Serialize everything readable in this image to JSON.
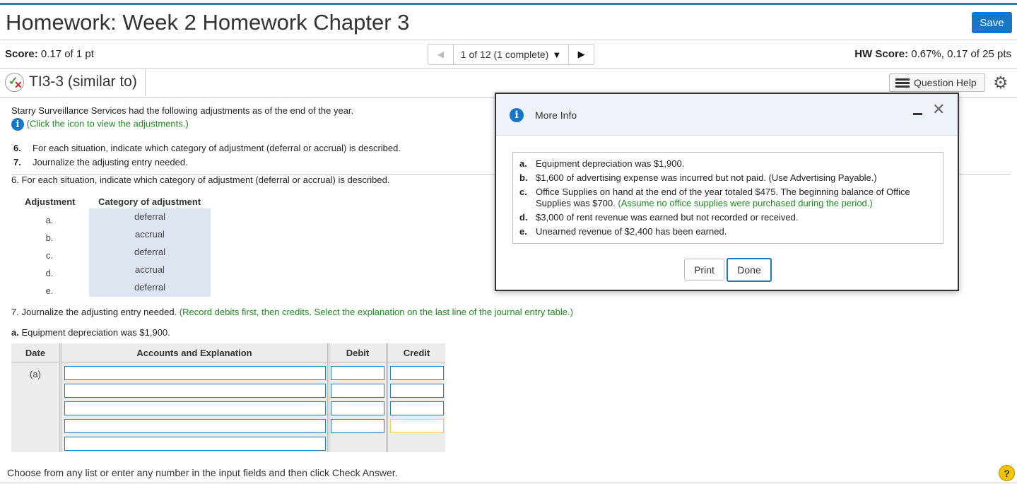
{
  "header": {
    "title": "Homework: Week 2 Homework Chapter 3",
    "save_label": "Save"
  },
  "status_bar": {
    "score_label": "Score:",
    "score_value": " 0.17 of 1 pt",
    "pager_text": "1 of 12 (1 complete)",
    "hw_score_label": "HW Score:",
    "hw_score_value": " 0.67%, 0.17 of 25 pts"
  },
  "question": {
    "title": "TI3-3 (similar to)",
    "help_label": "Question Help"
  },
  "body": {
    "intro": "Starry Surveillance Services had the following adjustments as of the end of the year.",
    "click_icon": "(Click the icon to view the adjustments.)",
    "req6_num": "6.",
    "req6_text": "For each situation, indicate which category of adjustment (deferral or accrual) is described.",
    "req7_num": "7.",
    "req7_text": "Journalize the adjusting entry needed.",
    "part6_heading": "6. For each situation, indicate which category of adjustment (deferral or accrual) is described.",
    "col_adjustment": "Adjustment",
    "col_category": "Category of adjustment",
    "adjustments": [
      {
        "letter": "a.",
        "category": "deferral"
      },
      {
        "letter": "b.",
        "category": "accrual"
      },
      {
        "letter": "c.",
        "category": "deferral"
      },
      {
        "letter": "d.",
        "category": "accrual"
      },
      {
        "letter": "e.",
        "category": "deferral"
      }
    ],
    "part7_heading": "7. Journalize the adjusting entry needed.",
    "part7_note": "(Record debits first, then credits. Select the explanation on the last line of the journal entry table.)",
    "part_a_label": "a.",
    "part_a_text": "Equipment depreciation was $1,900."
  },
  "journal": {
    "col_date": "Date",
    "col_accounts": "Accounts and Explanation",
    "col_debit": "Debit",
    "col_credit": "Credit",
    "date_value": "(a)"
  },
  "footer": {
    "instruction": "Choose from any list or enter any number in the input fields and then click Check Answer.",
    "help_symbol": "?"
  },
  "modal": {
    "title": "More Info",
    "items": [
      {
        "label": "a.",
        "text": "Equipment depreciation was $1,900."
      },
      {
        "label": "b.",
        "text": "$1,600 of advertising expense was incurred but not paid. (Use Advertising Payable.)"
      },
      {
        "label": "c.",
        "text": "Office Supplies on hand at the end of the year totaled $475. The beginning balance of Office Supplies was $700.",
        "note": "(Assume no office supplies were purchased during the period.)"
      },
      {
        "label": "d.",
        "text": "$3,000 of rent revenue was earned but not recorded or received."
      },
      {
        "label": "e.",
        "text": "Unearned revenue of $2,400 has been earned."
      }
    ],
    "print_label": "Print",
    "done_label": "Done"
  },
  "colors": {
    "accent": "#1677c9",
    "instruction_green": "#1e8a1e",
    "category_cell_bg": "#dde5f2"
  },
  "icons": [
    "info-icon",
    "gear-icon",
    "question-help-list-icon",
    "close-icon",
    "minimize-icon",
    "prev-arrow-icon",
    "next-arrow-icon",
    "dropdown-caret-icon",
    "partial-credit-status-icon",
    "help-icon"
  ]
}
